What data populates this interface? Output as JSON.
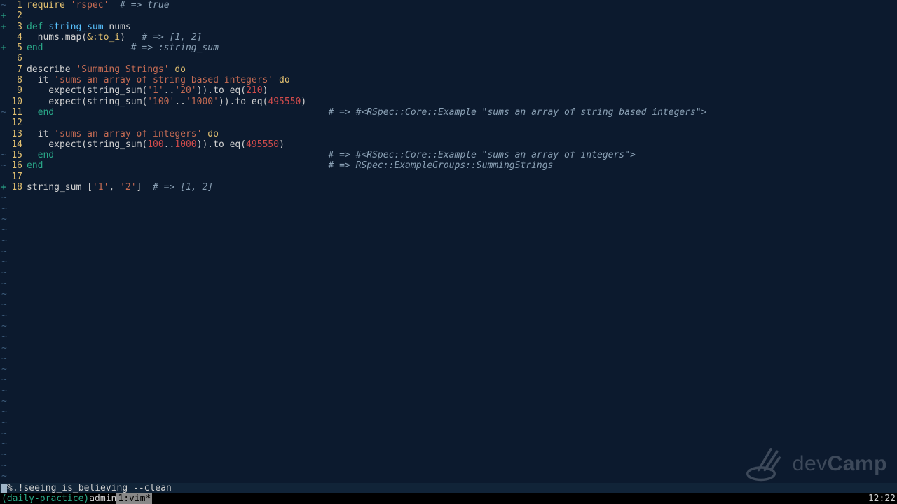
{
  "gutters": {
    "tilde": "~",
    "plus": "+",
    "blank_tilde": "~"
  },
  "lines": [
    {
      "n": 1,
      "sign": "tilde",
      "tokens": [
        [
          "kw",
          "require "
        ],
        [
          "str",
          "'rspec'"
        ],
        [
          "plain",
          "  "
        ],
        [
          "comment",
          "# => true"
        ]
      ]
    },
    {
      "n": 2,
      "sign": "plus",
      "tokens": []
    },
    {
      "n": 3,
      "sign": "plus",
      "tokens": [
        [
          "def",
          "def "
        ],
        [
          "fn",
          "string_sum "
        ],
        [
          "plain",
          "nums"
        ]
      ]
    },
    {
      "n": 4,
      "sign": "none",
      "tokens": [
        [
          "plain",
          "  nums.map("
        ],
        [
          "sym",
          "&"
        ],
        [
          "sym",
          ":to_i"
        ],
        [
          "plain",
          ")   "
        ],
        [
          "comment",
          "# => [1, 2]"
        ]
      ]
    },
    {
      "n": 5,
      "sign": "plus",
      "tokens": [
        [
          "def",
          "end"
        ],
        [
          "plain",
          "                "
        ],
        [
          "comment",
          "# => :string_sum"
        ]
      ]
    },
    {
      "n": 6,
      "sign": "none",
      "tokens": []
    },
    {
      "n": 7,
      "sign": "none",
      "tokens": [
        [
          "plain",
          "describe "
        ],
        [
          "str",
          "'Summing Strings'"
        ],
        [
          "kw",
          " do"
        ]
      ]
    },
    {
      "n": 8,
      "sign": "none",
      "tokens": [
        [
          "plain",
          "  it "
        ],
        [
          "str",
          "'sums an array of string based integers'"
        ],
        [
          "kw",
          " do"
        ]
      ]
    },
    {
      "n": 9,
      "sign": "none",
      "tokens": [
        [
          "plain",
          "    expect(string_sum("
        ],
        [
          "str",
          "'1'"
        ],
        [
          "plain",
          ".."
        ],
        [
          "str",
          "'20'"
        ],
        [
          "plain",
          ")).to eq("
        ],
        [
          "num",
          "210"
        ],
        [
          "plain",
          ")"
        ]
      ]
    },
    {
      "n": 10,
      "sign": "none",
      "tokens": [
        [
          "plain",
          "    expect(string_sum("
        ],
        [
          "str",
          "'100'"
        ],
        [
          "plain",
          ".."
        ],
        [
          "str",
          "'1000'"
        ],
        [
          "plain",
          ")).to eq("
        ],
        [
          "num",
          "495550"
        ],
        [
          "plain",
          ")"
        ]
      ]
    },
    {
      "n": 11,
      "sign": "tilde",
      "tokens": [
        [
          "def",
          "  end"
        ],
        [
          "plain",
          "                                                  "
        ],
        [
          "comment",
          "# => #<RSpec::Core::Example \"sums an array of string based integers\">"
        ]
      ]
    },
    {
      "n": 12,
      "sign": "none",
      "tokens": []
    },
    {
      "n": 13,
      "sign": "none",
      "tokens": [
        [
          "plain",
          "  it "
        ],
        [
          "str",
          "'sums an array of integers'"
        ],
        [
          "kw",
          " do"
        ]
      ]
    },
    {
      "n": 14,
      "sign": "none",
      "tokens": [
        [
          "plain",
          "    expect(string_sum("
        ],
        [
          "num",
          "100"
        ],
        [
          "plain",
          ".."
        ],
        [
          "num",
          "1000"
        ],
        [
          "plain",
          ")).to eq("
        ],
        [
          "num",
          "495550"
        ],
        [
          "plain",
          ")"
        ]
      ]
    },
    {
      "n": 15,
      "sign": "tilde",
      "tokens": [
        [
          "def",
          "  end"
        ],
        [
          "plain",
          "                                                  "
        ],
        [
          "comment",
          "# => #<RSpec::Core::Example \"sums an array of integers\">"
        ]
      ]
    },
    {
      "n": 16,
      "sign": "tilde",
      "tokens": [
        [
          "def",
          "end"
        ],
        [
          "plain",
          "                                                    "
        ],
        [
          "comment",
          "# => RSpec::ExampleGroups::SummingStrings"
        ]
      ]
    },
    {
      "n": 17,
      "sign": "none",
      "tokens": []
    },
    {
      "n": 18,
      "sign": "plus",
      "tokens": [
        [
          "plain",
          "string_sum ["
        ],
        [
          "str",
          "'1'"
        ],
        [
          "plain",
          ", "
        ],
        [
          "str",
          "'2'"
        ],
        [
          "plain",
          "]  "
        ],
        [
          "comment",
          "# => [1, 2]"
        ]
      ]
    }
  ],
  "post_tilde_rows": 27,
  "cmdline": {
    "prefix": "%",
    "text": ".!seeing_is_believing --clean"
  },
  "tmux": {
    "session": "(daily-practice) ",
    "admin": "admin",
    "window": "1:vim*",
    "time": "12:22"
  },
  "watermark": {
    "brand_light": "dev",
    "brand_bold": "Camp"
  }
}
